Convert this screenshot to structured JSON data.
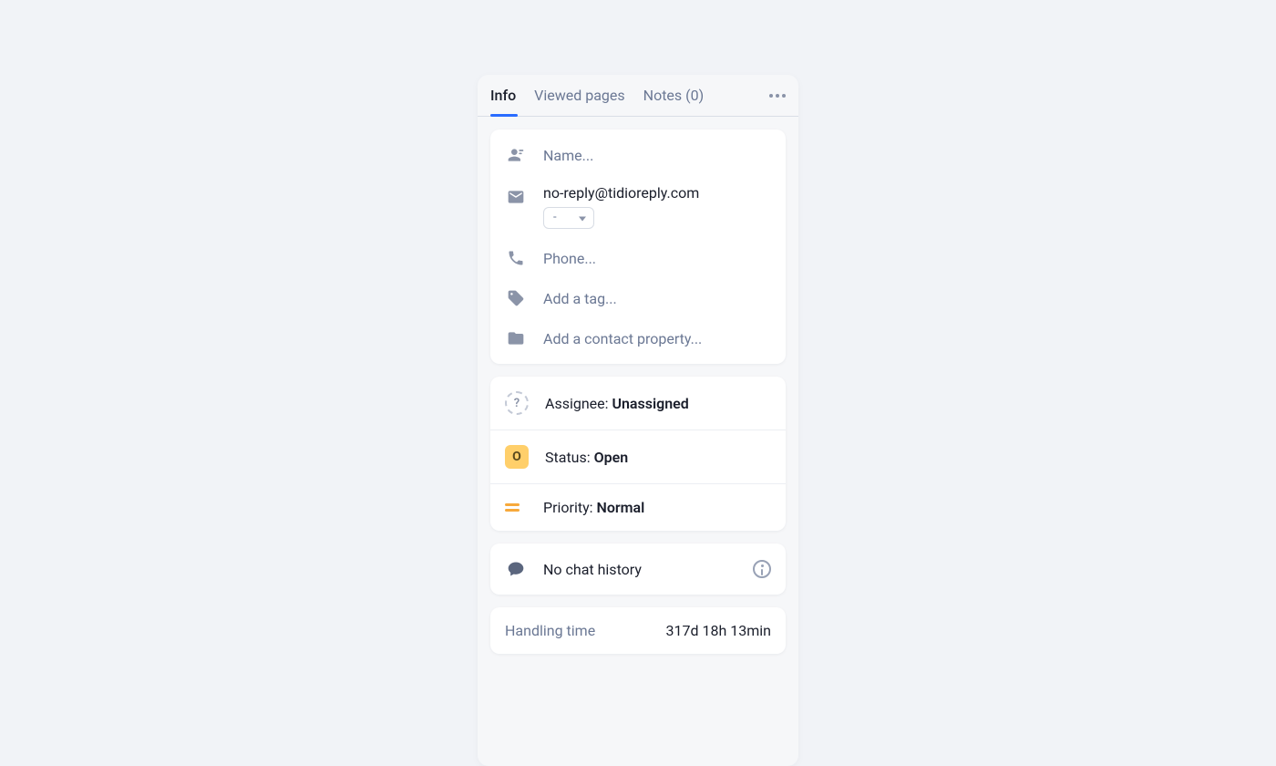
{
  "tabs": {
    "info": "Info",
    "viewed": "Viewed pages",
    "notes": "Notes (0)"
  },
  "contact": {
    "name_placeholder": "Name...",
    "email": "no-reply@tidioreply.com",
    "email_select": "-",
    "phone_placeholder": "Phone...",
    "tag_placeholder": "Add a tag...",
    "property_placeholder": "Add a contact property..."
  },
  "meta": {
    "assignee_avatar": "?",
    "assignee_label": "Assignee: ",
    "assignee_value": "Unassigned",
    "status_chip": "O",
    "status_label": "Status: ",
    "status_value": "Open",
    "priority_label": "Priority: ",
    "priority_value": "Normal"
  },
  "chat": {
    "text": "No chat history"
  },
  "handling": {
    "label": "Handling time",
    "value": "317d 18h 13min"
  }
}
